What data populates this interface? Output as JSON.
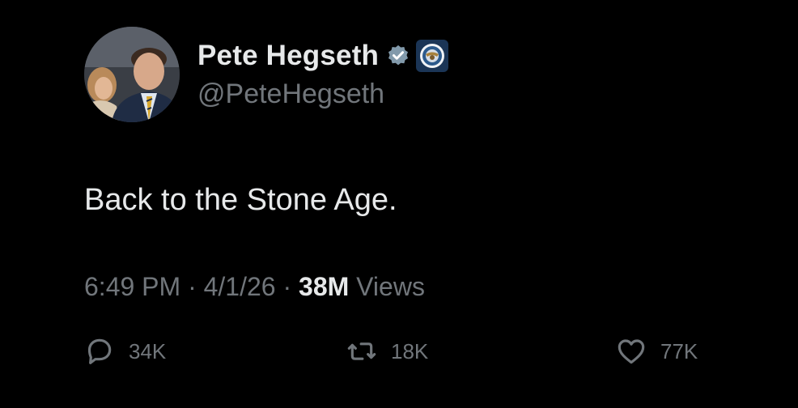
{
  "author": {
    "display_name": "Pete Hegseth",
    "handle": "@PeteHegseth",
    "avatar_icon": "profile-photo",
    "verified_icon": "verified-badge-icon",
    "verified_color": "#829aab",
    "affiliate_icon": "department-seal-icon"
  },
  "tweet": {
    "text": "Back to the Stone Age."
  },
  "meta": {
    "time": "6:49 PM",
    "separator": "·",
    "date": "4/1/26",
    "views_count": "38M",
    "views_label": "Views"
  },
  "actions": {
    "reply": {
      "icon": "reply-icon",
      "count": "34K"
    },
    "repost": {
      "icon": "repost-icon",
      "count": "18K"
    },
    "like": {
      "icon": "heart-icon",
      "count": "77K"
    }
  },
  "colors": {
    "background": "#000000",
    "primary_text": "#e7e9ea",
    "secondary_text": "#71767b"
  }
}
